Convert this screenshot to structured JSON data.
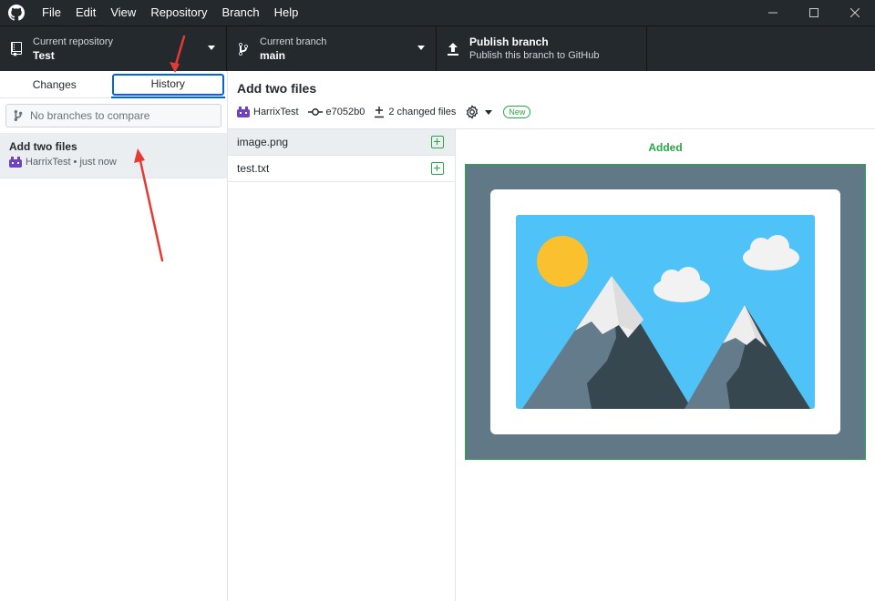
{
  "menu": {
    "items": [
      "File",
      "Edit",
      "View",
      "Repository",
      "Branch",
      "Help"
    ]
  },
  "toolbar": {
    "repo_label": "Current repository",
    "repo_value": "Test",
    "branch_label": "Current branch",
    "branch_value": "main",
    "publish_title": "Publish branch",
    "publish_desc": "Publish this branch to GitHub"
  },
  "sidebar": {
    "tabs": [
      "Changes",
      "History"
    ],
    "active_tab": "History",
    "compare_placeholder": "No branches to compare",
    "commit": {
      "title": "Add two files",
      "meta": "HarrixTest • just now"
    }
  },
  "commit_header": {
    "title": "Add two files",
    "author": "HarrixTest",
    "sha": "e7052b0",
    "changed": "2 changed files",
    "badge": "New"
  },
  "files": [
    {
      "name": "image.png",
      "status": "added"
    },
    {
      "name": "test.txt",
      "status": "added"
    }
  ],
  "diff": {
    "label": "Added"
  },
  "colors": {
    "chrome": "#24292e",
    "accent": "#0366d6",
    "added": "#28a745",
    "annotation": "#e53935"
  },
  "icons": [
    "github-logo-icon",
    "repo-icon",
    "branch-icon",
    "upload-icon",
    "caret-down-icon",
    "commit-icon",
    "plus-minus-icon",
    "gear-icon",
    "file-added-icon",
    "minimize-icon",
    "maximize-icon",
    "close-icon"
  ]
}
